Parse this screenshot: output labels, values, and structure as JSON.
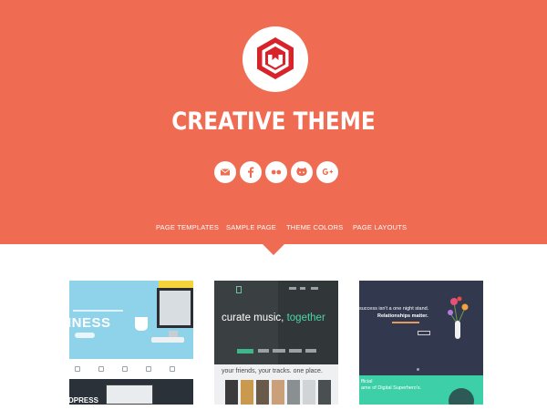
{
  "header": {
    "title": "CREATIVE THEME",
    "logo_icon": "creative-theme-logo",
    "background_color": "#ef6b52",
    "social": [
      {
        "name": "email-icon"
      },
      {
        "name": "facebook-icon"
      },
      {
        "name": "flickr-icon"
      },
      {
        "name": "github-icon"
      },
      {
        "name": "google-plus-icon"
      }
    ]
  },
  "nav": {
    "items": [
      "PAGE TEMPLATES",
      "SAMPLE PAGE",
      "THEME COLORS",
      "PAGE LAYOUTS"
    ],
    "active_index": 2
  },
  "thumbnails": [
    {
      "big_text": "INESS",
      "bottom_text": "DPRESS"
    },
    {
      "headline_start": "curate music, ",
      "headline_accent": "together",
      "subline": "your friends, your tracks. one place."
    },
    {
      "headline": [
        "success isn't a one night stand.",
        "Relationships matter."
      ],
      "bottom_text": [
        "fficial",
        "ame of Digital Superhero's."
      ]
    }
  ]
}
